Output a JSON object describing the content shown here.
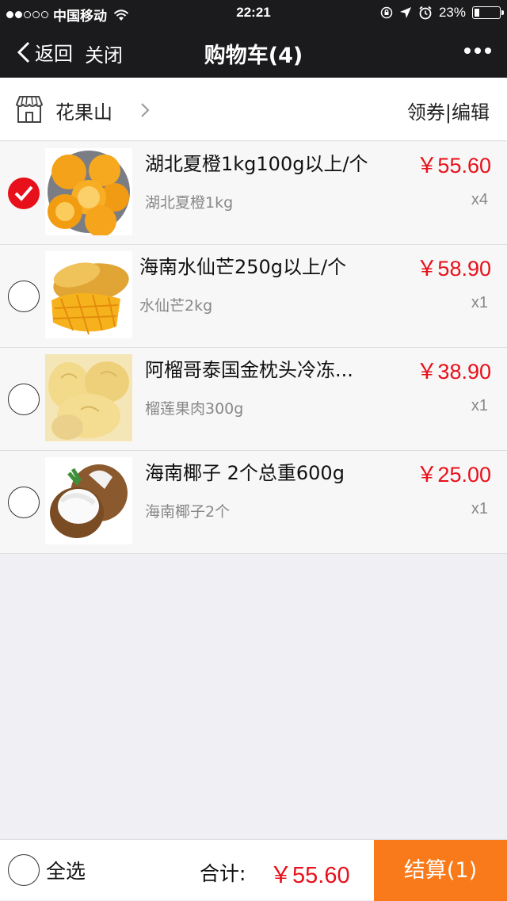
{
  "status_bar": {
    "carrier": "中国移动",
    "time": "22:21",
    "battery": "23%",
    "battery_level": 0.23
  },
  "nav": {
    "back_label": "返回",
    "close_label": "关闭",
    "title": "购物车(4)"
  },
  "shop": {
    "name": "花果山",
    "coupon_label": "领券",
    "separator": "|",
    "edit_label": "编辑"
  },
  "items": [
    {
      "name": "湖北夏橙1kg100g以上/个",
      "spec": "湖北夏橙1kg",
      "price": "￥55.60",
      "qty": "x4",
      "checked": true,
      "image": "orange-image"
    },
    {
      "name": "海南水仙芒250g以上/个",
      "spec": "水仙芒2kg",
      "price": "￥58.90",
      "qty": "x1",
      "checked": false,
      "image": "mango-image"
    },
    {
      "name": "阿榴哥泰国金枕头冷冻...",
      "spec": "榴莲果肉300g",
      "price": "￥38.90",
      "qty": "x1",
      "checked": false,
      "image": "durian-image"
    },
    {
      "name": "海南椰子 2个总重600g",
      "spec": "海南椰子2个",
      "price": "￥25.00",
      "qty": "x1",
      "checked": false,
      "image": "coconut-image"
    }
  ],
  "footer": {
    "select_all_label": "全选",
    "total_label": "合计:",
    "total_value": "￥55.60",
    "checkout_label": "结算(1)"
  },
  "colors": {
    "accent_red": "#e8101a",
    "checkout_orange": "#f97a1a",
    "nav_background": "#1b1b1d"
  }
}
